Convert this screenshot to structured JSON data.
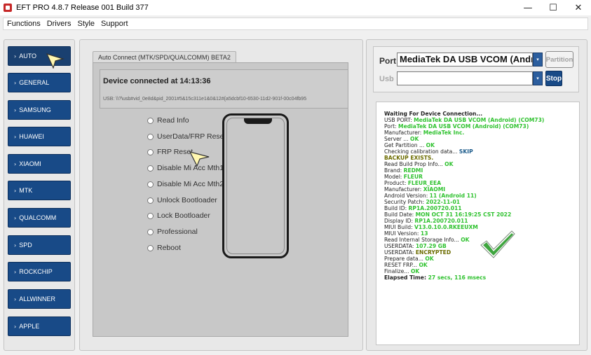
{
  "window": {
    "title": "EFT PRO 4.8.7 Release 001 Build 377",
    "minimize": "—",
    "maximize": "☐",
    "close": "✕"
  },
  "menu": [
    "Functions",
    "Drivers",
    "Style",
    "Support"
  ],
  "sidebar": {
    "items": [
      "AUTO",
      "GENERAL",
      "SAMSUNG",
      "HUAWEI",
      "XIAOMI",
      "MTK",
      "QUALCOMM",
      "SPD",
      "ROCKCHIP",
      "ALLWINNER",
      "APPLE"
    ],
    "active": "AUTO"
  },
  "center": {
    "tab_label": "Auto Connect (MTK/SPD/QUALCOMM) BETA2",
    "device_status": "Device connected at 14:13:36",
    "usb_path": "USB: \\\\?\\usb#vid_0e8d&pid_2001#5&15c311e1&0&12#{a5dcbf10-6530-11d2-901f-00c04fb95",
    "options": [
      "Read Info",
      "UserData/FRP Reset",
      "FRP Reset",
      "Disable Mi Acc Mth1",
      "Disable Mi Acc Mth2",
      "Unlock Bootloader",
      "Lock Bootloader",
      "Professional",
      "Reboot"
    ]
  },
  "connection": {
    "port_label": "Port",
    "port_value": "MediaTek DA USB VCOM (Android)",
    "usb_label": "Usb",
    "usb_value": "",
    "partition_button": "Partition",
    "stop_button": "Stop",
    "dropdown_glyph": "▾"
  },
  "log": [
    {
      "t": "Waiting For Device Connection...",
      "c": "bold"
    },
    {
      "t": "USB PORT: ",
      "v": "MediaTek DA USB VCOM (Android) (COM73)",
      "c": "g"
    },
    {
      "t": "Port: ",
      "v": "MediaTek DA USB VCOM (Android) (COM73)",
      "c": "g"
    },
    {
      "t": "Manufacturer: ",
      "v": "MediaTek Inc.",
      "c": "g"
    },
    {
      "t": "Server ... ",
      "v": "OK",
      "c": "g"
    },
    {
      "t": "Get Partition ... ",
      "v": "OK",
      "c": "g"
    },
    {
      "t": "Checking calibration data... ",
      "v": "SKIP",
      "c": "b"
    },
    {
      "t": "   ",
      "v": "BACKUP EXISTS.",
      "c": "y"
    },
    {
      "t": "Read Build Prop Info... ",
      "v": "OK",
      "c": "g"
    },
    {
      "t": "  Brand: ",
      "v": "REDMI",
      "c": "g"
    },
    {
      "t": "  Model: ",
      "v": "FLEUR",
      "c": "g"
    },
    {
      "t": "  Product: ",
      "v": "FLEUR_EEA",
      "c": "g"
    },
    {
      "t": "  Manufacturer: ",
      "v": "XIAOMI",
      "c": "g"
    },
    {
      "t": "  Android Version: ",
      "v": "11 (Android 11)",
      "c": "g"
    },
    {
      "t": "  Security Patch: ",
      "v": "2022-11-01",
      "c": "g"
    },
    {
      "t": "  Build ID: ",
      "v": "RP1A.200720.011",
      "c": "g"
    },
    {
      "t": "  Build Date: ",
      "v": "MON OCT 31 16:19:25 CST 2022",
      "c": "g"
    },
    {
      "t": "  Display ID: ",
      "v": "RP1A.200720.011",
      "c": "g"
    },
    {
      "t": "  MIUI Build: ",
      "v": "V13.0.10.0.RKEEUXM",
      "c": "g"
    },
    {
      "t": "  MIUI Version: ",
      "v": "13",
      "c": "g"
    },
    {
      "t": "Read Internal Storage Info... ",
      "v": "OK",
      "c": "g"
    },
    {
      "t": "USERDATA: ",
      "v": "107.29 GB",
      "c": "g"
    },
    {
      "t": "USERDATA: ",
      "v": "ENCRYPTED",
      "c": "y"
    },
    {
      "t": "Prepare data... ",
      "v": "OK",
      "c": "g"
    },
    {
      "t": "RESET FRP... ",
      "v": "OK",
      "c": "g"
    },
    {
      "t": "Finalize... ",
      "v": "OK",
      "c": "g"
    },
    {
      "t": "Elapsed Time: ",
      "v": "27 secs, 116 msecs",
      "c": "g",
      "bold": true
    }
  ],
  "colors": {
    "accent": "#184a87",
    "ok": "#2fc22f",
    "checkmark": "#3ea53e"
  }
}
